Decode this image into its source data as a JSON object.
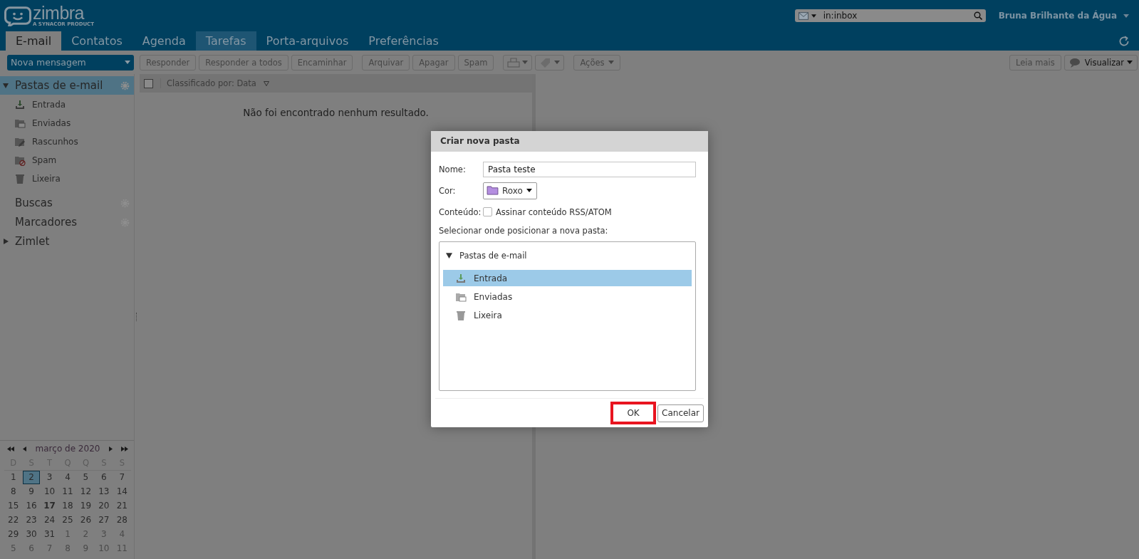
{
  "header": {
    "logo": "zimbra",
    "logo_tagline": "A SYNACOR PRODUCT",
    "search": {
      "value": "in:inbox"
    },
    "user": "Bruna Brilhante da Água"
  },
  "tabs": [
    {
      "label": "E-mail",
      "selected": true,
      "hover": false
    },
    {
      "label": "Contatos",
      "selected": false,
      "hover": false
    },
    {
      "label": "Agenda",
      "selected": false,
      "hover": false
    },
    {
      "label": "Tarefas",
      "selected": false,
      "hover": true
    },
    {
      "label": "Porta-arquivos",
      "selected": false,
      "hover": false
    },
    {
      "label": "Preferências",
      "selected": false,
      "hover": false
    }
  ],
  "toolbar": {
    "new_button": "Nova mensagem",
    "buttons": [
      {
        "kind": "text",
        "label": "Responder"
      },
      {
        "kind": "text",
        "label": "Responder a todos"
      },
      {
        "kind": "text",
        "label": "Encaminhar"
      },
      {
        "kind": "gap"
      },
      {
        "kind": "text",
        "label": "Arquivar"
      },
      {
        "kind": "text",
        "label": "Apagar"
      },
      {
        "kind": "text",
        "label": "Spam"
      },
      {
        "kind": "gap"
      },
      {
        "kind": "print-menu"
      },
      {
        "kind": "tag-menu"
      },
      {
        "kind": "gap"
      },
      {
        "kind": "menu",
        "label": "Ações"
      }
    ],
    "right_buttons": [
      {
        "kind": "text",
        "label": "Leia mais"
      },
      {
        "kind": "view-menu",
        "label": "Visualizar"
      }
    ]
  },
  "sidebar": {
    "sections": [
      {
        "label": "Pastas de e-mail",
        "kind": "tree",
        "expanded": true,
        "selected": true,
        "gear": true,
        "children": [
          {
            "label": "Entrada",
            "kind": "inbox"
          },
          {
            "label": "Enviadas",
            "kind": "sent"
          },
          {
            "label": "Rascunhos",
            "kind": "drafts"
          },
          {
            "label": "Spam",
            "kind": "spam"
          },
          {
            "label": "Lixeira",
            "kind": "trash"
          }
        ]
      },
      {
        "label": "Buscas",
        "kind": "plain",
        "selected": false,
        "gear": true
      },
      {
        "label": "Marcadores",
        "kind": "plain",
        "selected": false,
        "gear": true
      },
      {
        "label": "Zimlet",
        "kind": "tree",
        "expanded": false,
        "selected": false,
        "gear": false
      }
    ]
  },
  "calendar": {
    "month": "março de 2020",
    "weekdays": [
      "D",
      "S",
      "T",
      "Q",
      "Q",
      "S",
      "S"
    ],
    "weeks": [
      [
        {
          "d": "1",
          "other": false,
          "selected": false,
          "today": false
        },
        {
          "d": "2",
          "other": false,
          "selected": true,
          "today": false
        },
        {
          "d": "3",
          "other": false,
          "selected": false,
          "today": false
        },
        {
          "d": "4",
          "other": false,
          "selected": false,
          "today": false
        },
        {
          "d": "5",
          "other": false,
          "selected": false,
          "today": false
        },
        {
          "d": "6",
          "other": false,
          "selected": false,
          "today": false
        },
        {
          "d": "7",
          "other": false,
          "selected": false,
          "today": false
        }
      ],
      [
        {
          "d": "8",
          "other": false,
          "selected": false,
          "today": false
        },
        {
          "d": "9",
          "other": false,
          "selected": false,
          "today": false
        },
        {
          "d": "10",
          "other": false,
          "selected": false,
          "today": false
        },
        {
          "d": "11",
          "other": false,
          "selected": false,
          "today": false
        },
        {
          "d": "12",
          "other": false,
          "selected": false,
          "today": false
        },
        {
          "d": "13",
          "other": false,
          "selected": false,
          "today": false
        },
        {
          "d": "14",
          "other": false,
          "selected": false,
          "today": false
        }
      ],
      [
        {
          "d": "15",
          "other": false,
          "selected": false,
          "today": false
        },
        {
          "d": "16",
          "other": false,
          "selected": false,
          "today": false
        },
        {
          "d": "17",
          "other": false,
          "selected": false,
          "today": true
        },
        {
          "d": "18",
          "other": false,
          "selected": false,
          "today": false
        },
        {
          "d": "19",
          "other": false,
          "selected": false,
          "today": false
        },
        {
          "d": "20",
          "other": false,
          "selected": false,
          "today": false
        },
        {
          "d": "21",
          "other": false,
          "selected": false,
          "today": false
        }
      ],
      [
        {
          "d": "22",
          "other": false,
          "selected": false,
          "today": false
        },
        {
          "d": "23",
          "other": false,
          "selected": false,
          "today": false
        },
        {
          "d": "24",
          "other": false,
          "selected": false,
          "today": false
        },
        {
          "d": "25",
          "other": false,
          "selected": false,
          "today": false
        },
        {
          "d": "26",
          "other": false,
          "selected": false,
          "today": false
        },
        {
          "d": "27",
          "other": false,
          "selected": false,
          "today": false
        },
        {
          "d": "28",
          "other": false,
          "selected": false,
          "today": false
        }
      ],
      [
        {
          "d": "29",
          "other": false,
          "selected": false,
          "today": false
        },
        {
          "d": "30",
          "other": false,
          "selected": false,
          "today": false
        },
        {
          "d": "31",
          "other": false,
          "selected": false,
          "today": false
        },
        {
          "d": "1",
          "other": true,
          "selected": false,
          "today": false
        },
        {
          "d": "2",
          "other": true,
          "selected": false,
          "today": false
        },
        {
          "d": "3",
          "other": true,
          "selected": false,
          "today": false
        },
        {
          "d": "4",
          "other": true,
          "selected": false,
          "today": false
        }
      ],
      [
        {
          "d": "5",
          "other": true,
          "selected": false,
          "today": false
        },
        {
          "d": "6",
          "other": true,
          "selected": false,
          "today": false
        },
        {
          "d": "7",
          "other": true,
          "selected": false,
          "today": false
        },
        {
          "d": "8",
          "other": true,
          "selected": false,
          "today": false
        },
        {
          "d": "9",
          "other": true,
          "selected": false,
          "today": false
        },
        {
          "d": "10",
          "other": true,
          "selected": false,
          "today": false
        },
        {
          "d": "11",
          "other": true,
          "selected": false,
          "today": false
        }
      ]
    ]
  },
  "message_list": {
    "checked": false,
    "sort_label": "Classificado por: Data",
    "empty_text": "Não foi encontrado nenhum resultado."
  },
  "dialog": {
    "title": "Criar nova pasta",
    "name_label": "Nome:",
    "name_value": "Pasta teste",
    "color_label": "Cor:",
    "color_value": "Roxo",
    "color": "#b48ee0",
    "content_label": "Conteúdo:",
    "rss": {
      "label": "Assinar conteúdo RSS/ATOM",
      "checked": false
    },
    "location_label": "Selecionar onde posicionar a nova pasta:",
    "tree": {
      "label": "Pastas de e-mail",
      "expanded": true,
      "children": [
        {
          "label": "Entrada",
          "kind": "inbox",
          "selected": true
        },
        {
          "label": "Enviadas",
          "kind": "sent",
          "selected": false
        },
        {
          "label": "Lixeira",
          "kind": "trash",
          "selected": false
        }
      ]
    },
    "buttons": [
      {
        "label": "OK",
        "highlighted": true
      },
      {
        "label": "Cancelar",
        "highlighted": false
      }
    ]
  }
}
